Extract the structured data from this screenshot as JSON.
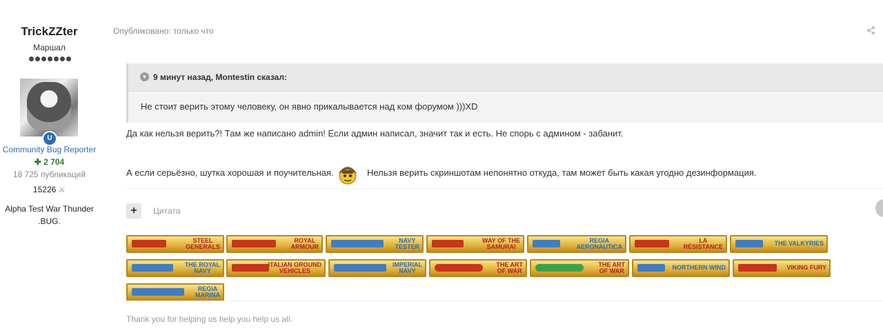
{
  "author": {
    "name": "TrickZZter",
    "rank": "Маршал",
    "badge_letter": "U",
    "group": "Community Bug Reporter",
    "reputation": "2 704",
    "posts": "18 725 публикаций",
    "points": "15226",
    "title_line1": "Alpha Test War Thunder",
    "title_line2": ".BUG."
  },
  "post": {
    "published": "Опубликовано: только что",
    "quote": {
      "header": "9 минут назад, Montestin сказал:",
      "body": "Не стоит верить этому человеку, он явно прикалывается над ком форумом )))XD"
    },
    "paragraph1": "Да как нельзя верить?! Там же написано admin! Если админ написал, значит так и есть. Не спорь с админом - забанит.",
    "paragraph2a": "А если серьёзно, шутка хорошая и поучительная.",
    "paragraph2b": "Нельзя верить скриншотам непонятно откуда, там может быть какая угодно дезинформация.",
    "quote_button": "Цитата",
    "signature": "Thank you for helping us help you help us all."
  },
  "ribbons": [
    {
      "line1": "STEEL",
      "line2": "GENERALS",
      "color": "red",
      "text_color": "red"
    },
    {
      "line1": "ROYAL",
      "line2": "ARMOUR",
      "color": "red",
      "text_color": "red"
    },
    {
      "line1": "NAVY",
      "line2": "TESTER",
      "color": "blue",
      "text_color": "blue"
    },
    {
      "line1": "WAY OF THE",
      "line2": "SAMURAI",
      "color": "red",
      "text_color": "red"
    },
    {
      "line1": "REGIA",
      "line2": "AERONAUTICA",
      "color": "blue",
      "text_color": "blue"
    },
    {
      "line1": "LA",
      "line2": "RÉSISTANCE",
      "color": "red",
      "text_color": "red"
    },
    {
      "line1": "THE VALKYRIES",
      "line2": "",
      "color": "blue",
      "text_color": "blue"
    },
    {
      "line1": "THE ROYAL",
      "line2": "NAVY",
      "color": "blue",
      "text_color": "blue"
    },
    {
      "line1": "ITALIAN GROUND",
      "line2": "VEHICLES",
      "color": "red",
      "text_color": "red"
    },
    {
      "line1": "IMPERIAL",
      "line2": "NAVY",
      "color": "blue",
      "text_color": "blue"
    },
    {
      "line1": "THE ART",
      "line2": "OF WAR",
      "color": "red",
      "text_color": "red"
    },
    {
      "line1": "THE ART",
      "line2": "OF WAR",
      "color": "green",
      "text_color": "red"
    },
    {
      "line1": "NORTHERN WIND",
      "line2": "",
      "color": "blue",
      "text_color": "blue"
    },
    {
      "line1": "VIKING FURY",
      "line2": "",
      "color": "red",
      "text_color": "red"
    },
    {
      "line1": "REGIA",
      "line2": "MARINA",
      "color": "blue",
      "text_color": "blue"
    }
  ],
  "icons": {
    "share": "share-icon",
    "smiley": "aviator-smiley-icon",
    "crossed_swords": "crossed-swords-icon"
  }
}
